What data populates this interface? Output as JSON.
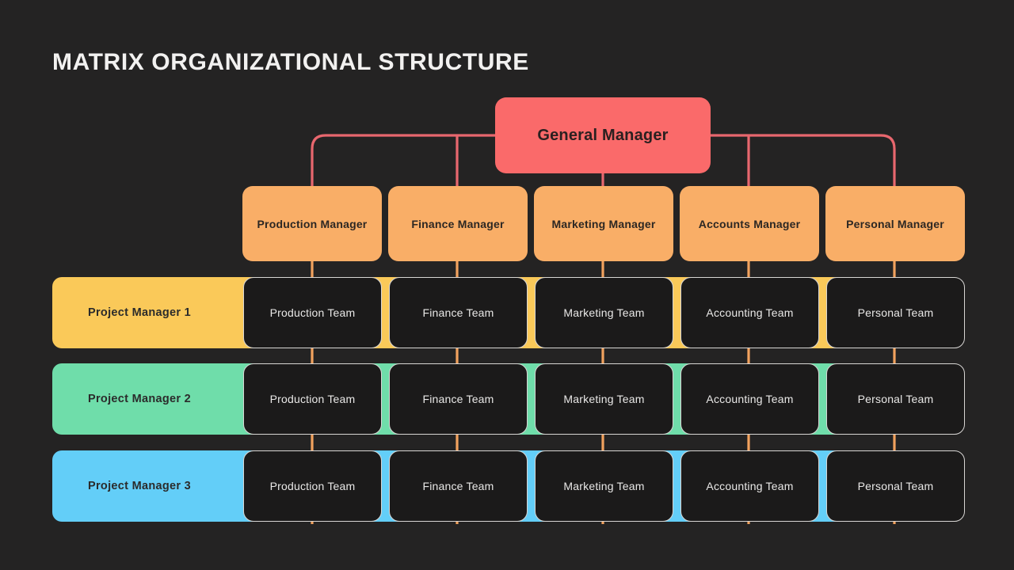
{
  "page": {
    "title": "MATRIX ORGANIZATIONAL STRUCTURE",
    "background_color": "#242323"
  },
  "colors": {
    "general_manager": "#FA6A6A",
    "manager": "#F9AE67",
    "connector_red": "#E8676E",
    "connector_orange": "#F2A25E",
    "team_box_bg": "#1B1A1A",
    "team_box_border": "#D8D6D4",
    "project_manager_1": "#FAC959",
    "project_manager_2": "#6FDDAA",
    "project_manager_3": "#63CEF8",
    "title_text": "#F2F1F0",
    "dark_text": "#2B2B2B",
    "light_text": "#E9E8E7"
  },
  "chart_data": {
    "type": "diagram",
    "diagram_kind": "matrix-organizational-chart",
    "title": "MATRIX ORGANIZATIONAL STRUCTURE",
    "root": "General Manager",
    "functional_columns": [
      "Production Manager",
      "Finance Manager",
      "Marketing Manager",
      "Accounts Manager",
      "Personal Manager"
    ],
    "project_rows": [
      "Project Manager 1",
      "Project Manager 2",
      "Project Manager 3"
    ],
    "cells": [
      [
        "Production Team",
        "Finance Team",
        "Marketing Team",
        "Accounting Team",
        "Personal Team"
      ],
      [
        "Production Team",
        "Finance Team",
        "Marketing Team",
        "Accounting Team",
        "Personal Team"
      ],
      [
        "Production Team",
        "Finance Team",
        "Marketing Team",
        "Accounting Team",
        "Personal Team"
      ]
    ]
  },
  "general_manager": {
    "label": "General Manager"
  },
  "managers": [
    {
      "label": "Production Manager"
    },
    {
      "label": "Finance Manager"
    },
    {
      "label": "Marketing Manager"
    },
    {
      "label": "Accounts Manager"
    },
    {
      "label": "Personal Manager"
    }
  ],
  "project_rows": [
    {
      "label": "Project Manager 1",
      "color": "#FAC959",
      "teams": [
        {
          "label": "Production Team"
        },
        {
          "label": "Finance Team"
        },
        {
          "label": "Marketing Team"
        },
        {
          "label": "Accounting Team"
        },
        {
          "label": "Personal Team"
        }
      ]
    },
    {
      "label": "Project Manager 2",
      "color": "#6FDDAA",
      "teams": [
        {
          "label": "Production Team"
        },
        {
          "label": "Finance Team"
        },
        {
          "label": "Marketing Team"
        },
        {
          "label": "Accounting Team"
        },
        {
          "label": "Personal Team"
        }
      ]
    },
    {
      "label": "Project Manager 3",
      "color": "#63CEF8",
      "teams": [
        {
          "label": "Production Team"
        },
        {
          "label": "Finance Team"
        },
        {
          "label": "Marketing Team"
        },
        {
          "label": "Accounting Team"
        },
        {
          "label": "Personal Team"
        }
      ]
    }
  ]
}
